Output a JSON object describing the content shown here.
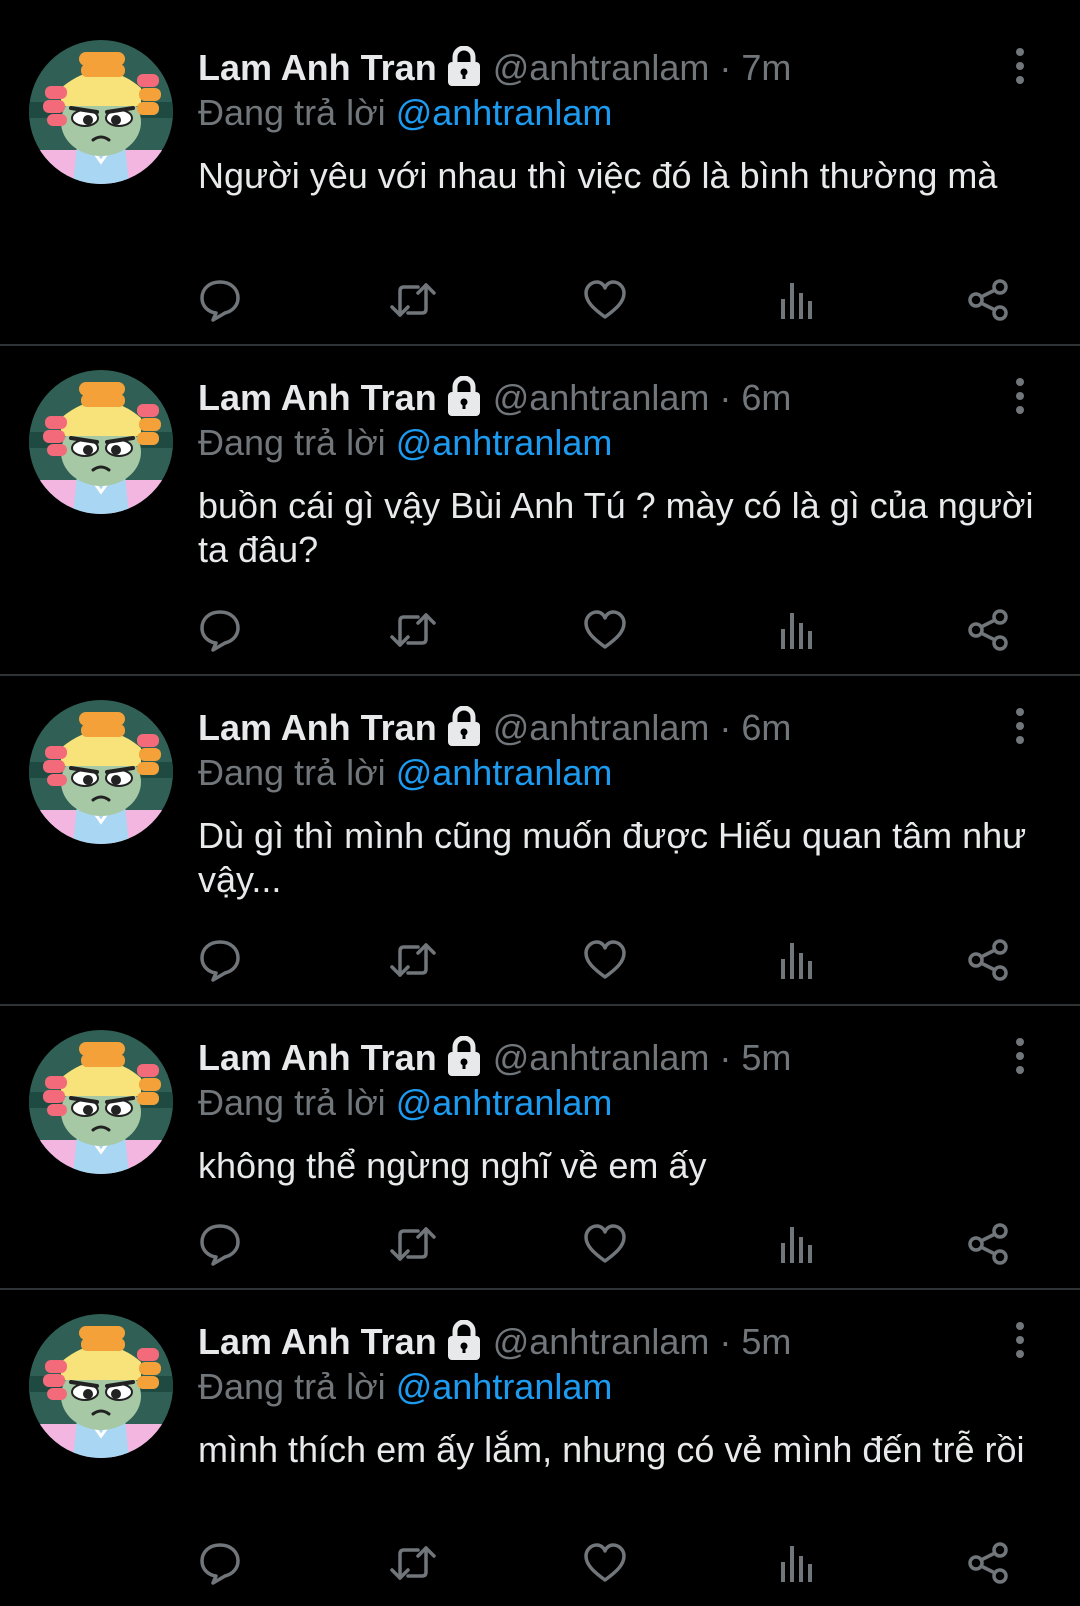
{
  "colors": {
    "background": "#000000",
    "primary_text": "#e7e9ea",
    "secondary_text": "#71767b",
    "link": "#1d9bf0",
    "divider": "#2f3336"
  },
  "icons": {
    "lock": "lock-icon",
    "more": "more-vertical-icon",
    "reply": "reply-icon",
    "retweet": "retweet-icon",
    "like": "heart-icon",
    "views": "views-icon",
    "share": "share-icon"
  },
  "tweets": [
    {
      "name": "Lam Anh Tran",
      "handle": "@anhtranlam",
      "separator": "·",
      "time": "7m",
      "reply_prefix": "Đang trả lời",
      "reply_to": "@anhtranlam",
      "text": "Người yêu với nhau thì việc đó là bình thường mà"
    },
    {
      "name": "Lam Anh Tran",
      "handle": "@anhtranlam",
      "separator": "·",
      "time": "6m",
      "reply_prefix": "Đang trả lời",
      "reply_to": "@anhtranlam",
      "text": "buồn cái gì vậy Bùi Anh Tú ? mày có là gì của người ta đâu?"
    },
    {
      "name": "Lam Anh Tran",
      "handle": "@anhtranlam",
      "separator": "·",
      "time": "6m",
      "reply_prefix": "Đang trả lời",
      "reply_to": "@anhtranlam",
      "text": "Dù gì thì mình cũng muốn được Hiếu quan tâm như vậy..."
    },
    {
      "name": "Lam Anh Tran",
      "handle": "@anhtranlam",
      "separator": "·",
      "time": "5m",
      "reply_prefix": "Đang trả lời",
      "reply_to": "@anhtranlam",
      "text": "không thể ngừng nghĩ về em ấy"
    },
    {
      "name": "Lam Anh Tran",
      "handle": "@anhtranlam",
      "separator": "·",
      "time": "5m",
      "reply_prefix": "Đang trả lời",
      "reply_to": "@anhtranlam",
      "text": "mình thích em ấy lắm, nhưng có vẻ mình đến trễ rồi"
    }
  ]
}
